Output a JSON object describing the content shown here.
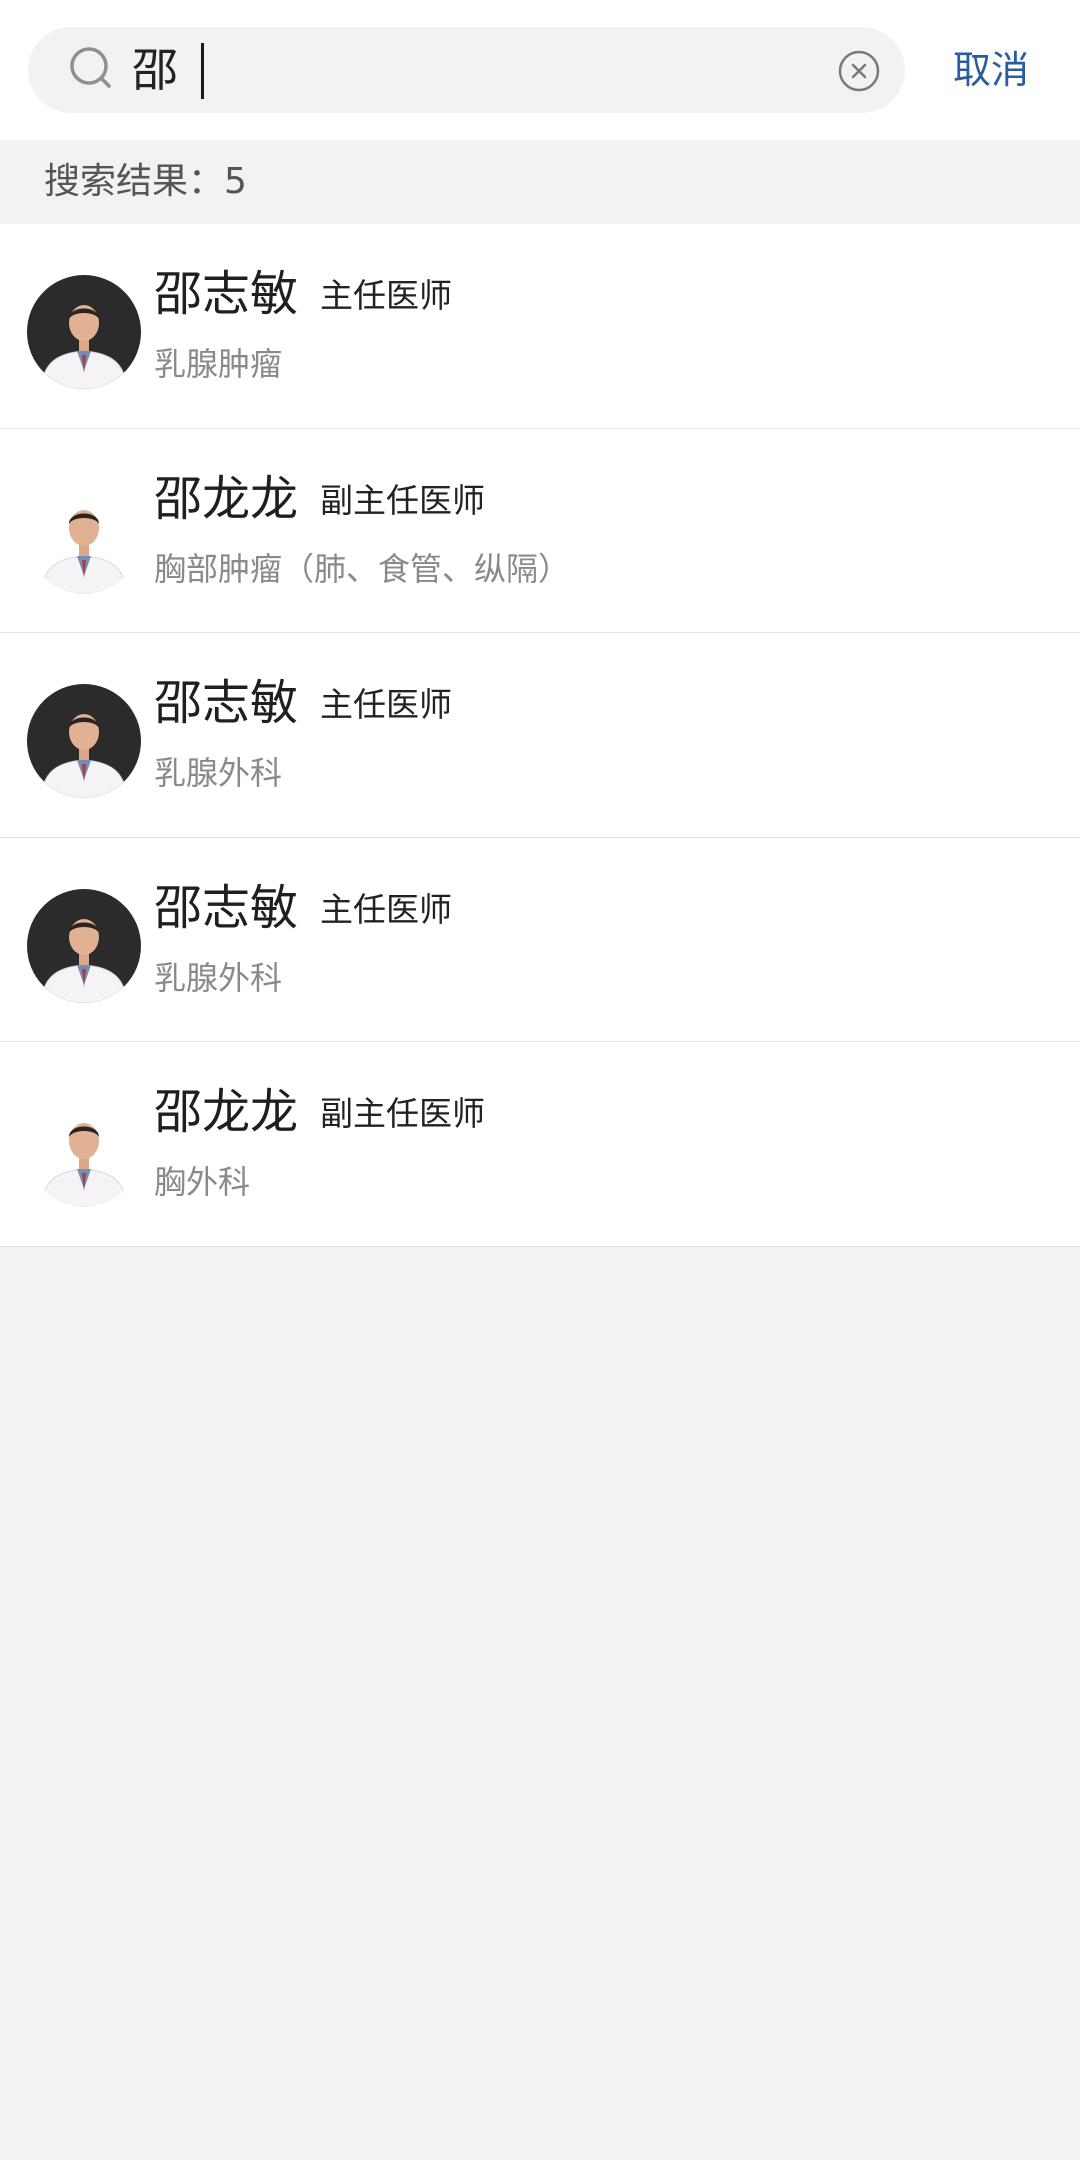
{
  "search": {
    "query": "邵",
    "cancel_label": "取消"
  },
  "results": {
    "label": "搜索结果：5"
  },
  "doctors": [
    {
      "name": "邵志敏",
      "title": "主任医师",
      "department": "乳腺肿瘤"
    },
    {
      "name": "邵龙龙",
      "title": "副主任医师",
      "department": "胸部肿瘤（肺、食管、纵隔）"
    },
    {
      "name": "邵志敏",
      "title": "主任医师",
      "department": "乳腺外科"
    },
    {
      "name": "邵志敏",
      "title": "主任医师",
      "department": "乳腺外科"
    },
    {
      "name": "邵龙龙",
      "title": "副主任医师",
      "department": "胸外科"
    }
  ],
  "colors": {
    "accent": "#2a5d9f",
    "page_background": "#f2f2f4"
  }
}
